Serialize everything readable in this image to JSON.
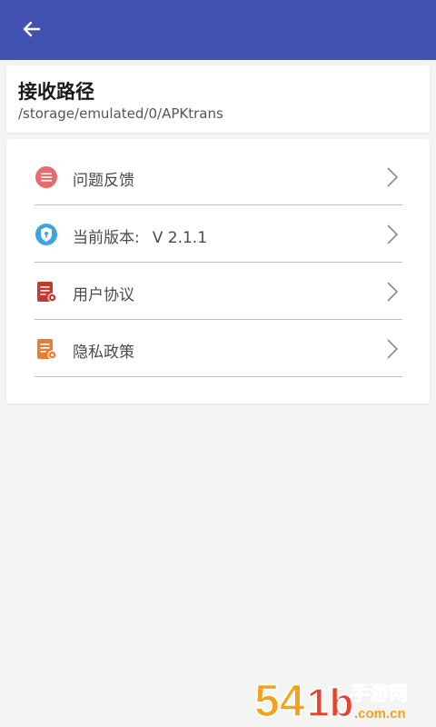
{
  "header": {
    "back_icon": "arrow-left-icon",
    "bg_color": "#4152b3"
  },
  "receive_path": {
    "title": "接收路径",
    "value": "/storage/emulated/0/APKtrans"
  },
  "menu": {
    "items": [
      {
        "label": "问题反馈",
        "icon": "message-icon",
        "color": "#e96a6a"
      },
      {
        "label": "当前版本:",
        "value": "V 2.1.1",
        "icon": "shield-lock-icon",
        "color": "#3aa5e0"
      },
      {
        "label": "用户协议",
        "icon": "document-red-icon",
        "color": "#c43a2f"
      },
      {
        "label": "隐私政策",
        "icon": "document-orange-icon",
        "color": "#ea7d31"
      }
    ]
  },
  "watermark": {
    "number": "54",
    "number2": "1b",
    "brand": "手游网",
    "domain": ".com.cn"
  }
}
